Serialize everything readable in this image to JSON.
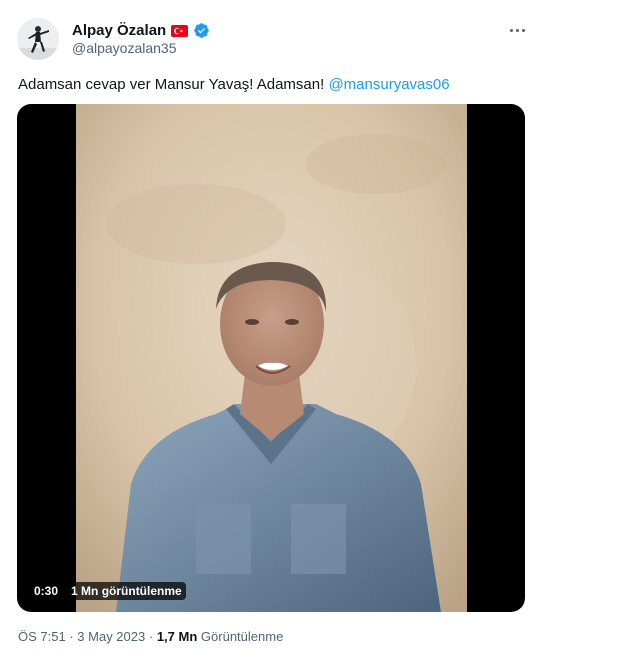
{
  "author": {
    "display_name": "Alpay Özalan",
    "handle": "@alpayozalan35",
    "flag_icon": "turkey-flag-icon",
    "verified_icon": "verified-badge-icon",
    "verified_color": "#1d9bf0"
  },
  "tweet": {
    "text": "Adamsan cevap ver Mansur Yavaş! Adamsan!",
    "mention": "@mansuryavas06",
    "mention_color": "#1d9bf0"
  },
  "video": {
    "duration": "0:30",
    "views": "1 Mn görüntülenme"
  },
  "meta": {
    "time": "ÖS 7:51",
    "separator": "·",
    "date": "3 May 2023",
    "view_count": "1,7 Mn",
    "view_label": "Görüntülenme"
  },
  "more_icon": "more-horizontal-icon"
}
